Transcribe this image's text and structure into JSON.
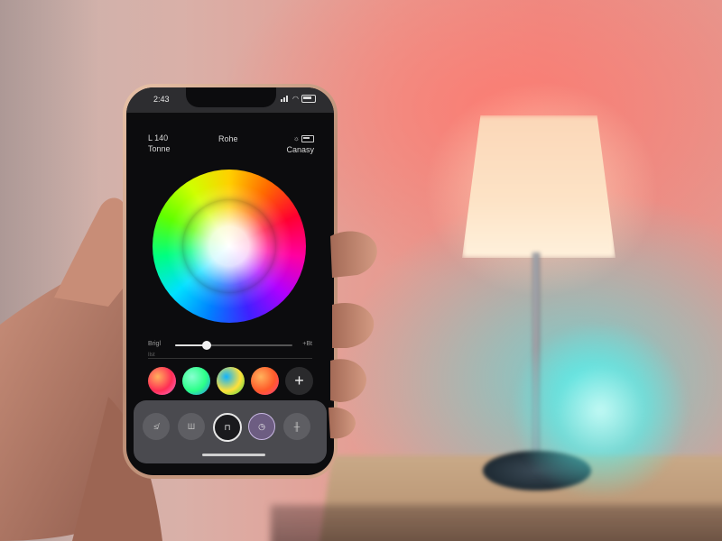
{
  "status_bar": {
    "time": "2:43"
  },
  "app_header": {
    "left_line1": "L 140",
    "left_line2": "Tonne",
    "center": "Rohe",
    "right": "Canasy"
  },
  "slider": {
    "left_label": "Brigl",
    "right_label": "+Bt",
    "sub_label": "Ilst",
    "value_fraction": 0.27
  },
  "presets": [
    {
      "name": "preset-red-magenta",
      "colors": [
        "#ff2d55",
        "#ff7ad9",
        "#ffb15c"
      ]
    },
    {
      "name": "preset-green-blue",
      "colors": [
        "#2bff88",
        "#2b7bff",
        "#88ffd0"
      ]
    },
    {
      "name": "preset-yellow-green",
      "colors": [
        "#ffe13a",
        "#33d14a",
        "#0fb3ff"
      ]
    },
    {
      "name": "preset-orange-pink",
      "colors": [
        "#ff5a2a",
        "#ff3d8b",
        "#ffb35c"
      ]
    }
  ],
  "add_button": {
    "label": "+"
  },
  "bottom_nav": [
    {
      "name": "nav-scenes",
      "glyph": "≰"
    },
    {
      "name": "nav-schedule",
      "glyph": "Ш"
    },
    {
      "name": "nav-color",
      "glyph": "⊓"
    },
    {
      "name": "nav-timer",
      "glyph": "◷"
    },
    {
      "name": "nav-adjust",
      "glyph": "╫"
    }
  ],
  "colors": {
    "screen_bg": "#0c0c0e",
    "phone_frame": "#c9987e",
    "bottom_bar": "#4a4a4f",
    "active_ring": "#e8e8e8",
    "timer_accent": "#6d5d82"
  }
}
